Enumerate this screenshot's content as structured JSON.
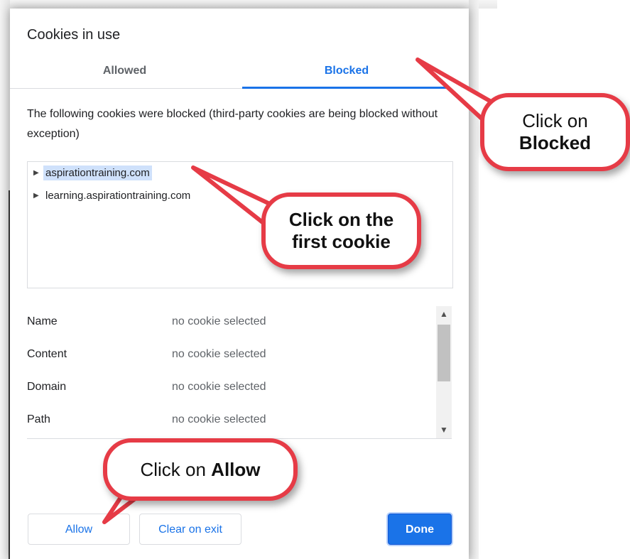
{
  "dialog": {
    "title": "Cookies in use",
    "tabs": [
      {
        "label": "Allowed",
        "selected": false
      },
      {
        "label": "Blocked",
        "selected": true
      }
    ],
    "description": "The following cookies were blocked (third-party cookies are being blocked without exception)",
    "tree": [
      {
        "label": "aspirationtraining.com",
        "selected": true
      },
      {
        "label": "learning.aspirationtraining.com",
        "selected": false
      }
    ],
    "details": [
      {
        "key": "Name",
        "value": "no cookie selected"
      },
      {
        "key": "Content",
        "value": "no cookie selected"
      },
      {
        "key": "Domain",
        "value": "no cookie selected"
      },
      {
        "key": "Path",
        "value": "no cookie selected"
      }
    ],
    "buttons": {
      "allow": "Allow",
      "clear_on_exit": "Clear on exit",
      "done": "Done"
    }
  },
  "callouts": {
    "blocked": {
      "line1": "Click on",
      "line2": "Blocked"
    },
    "cookie": {
      "line1": "Click on the",
      "line2": "first cookie"
    },
    "allow": {
      "prefix": "Click on ",
      "bold": "Allow"
    }
  },
  "colors": {
    "accent": "#1a73e8",
    "callout_border": "#e63b46",
    "selected_bg": "#cfe1fb"
  }
}
